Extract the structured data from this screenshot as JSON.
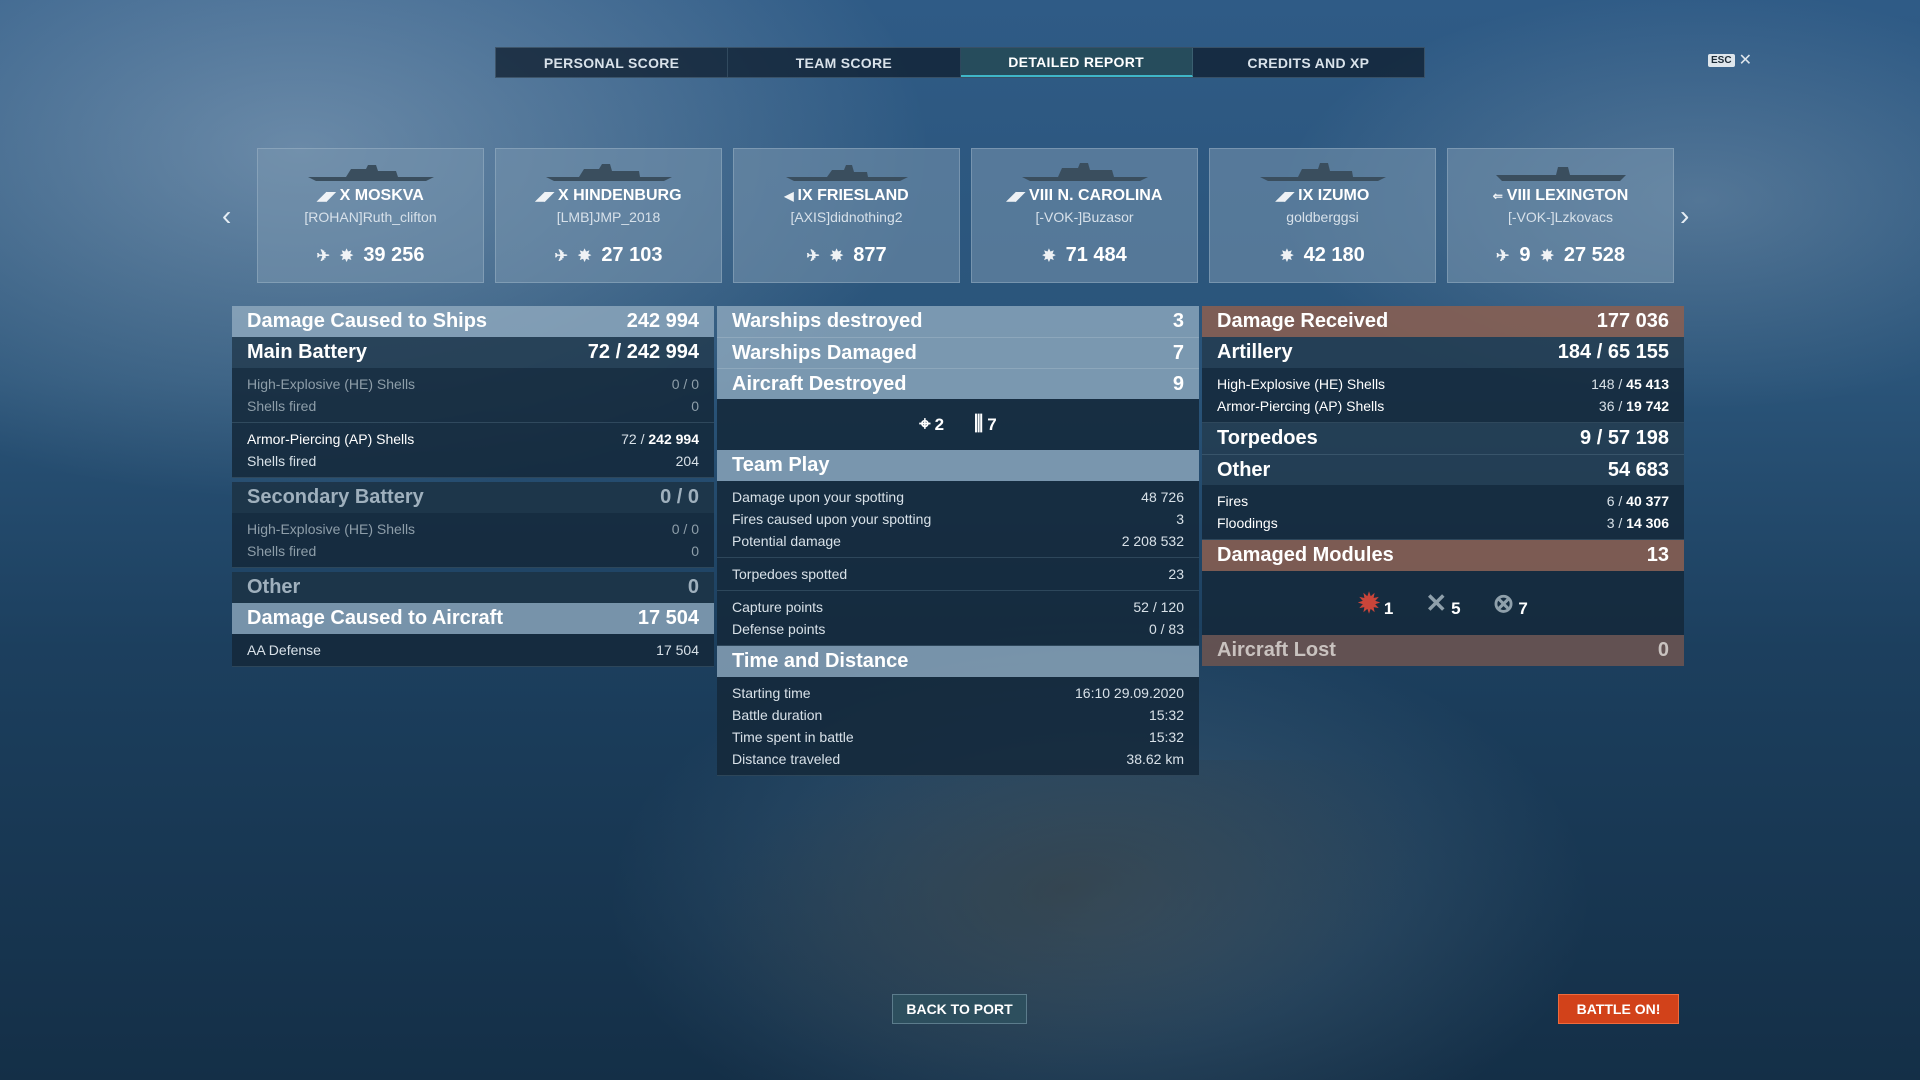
{
  "tabs": [
    {
      "label": "PERSONAL SCORE"
    },
    {
      "label": "TEAM SCORE"
    },
    {
      "label": "DETAILED REPORT"
    },
    {
      "label": "CREDITS AND XP"
    }
  ],
  "esc": {
    "key": "ESC",
    "close": "✕"
  },
  "ships": [
    {
      "tier": "X",
      "name": "MOSKVA",
      "player": "[ROHAN]Ruth_clifton",
      "damage": "39 256",
      "has_plane": true
    },
    {
      "tier": "X",
      "name": "HINDENBURG",
      "player": "[LMB]JMP_2018",
      "damage": "27 103",
      "has_plane": true
    },
    {
      "tier": "IX",
      "name": "FRIESLAND",
      "player": "[AXIS]didnothing2",
      "damage": "877",
      "has_plane": true
    },
    {
      "tier": "VIII",
      "name": "N. CAROLINA",
      "player": "[-VOK-]Buzasor",
      "damage": "71 484",
      "has_plane": false
    },
    {
      "tier": "IX",
      "name": "IZUMO",
      "player": "goldberggsi",
      "damage": "42 180",
      "has_plane": false
    },
    {
      "tier": "VIII",
      "name": "LEXINGTON",
      "player": "[-VOK-]Lzkovacs",
      "damage": "27 528",
      "planes_shot": "9"
    }
  ],
  "left": {
    "damage_ships": {
      "label": "Damage Caused to Ships",
      "value": "242 994"
    },
    "main_battery": {
      "label": "Main Battery",
      "hits": "72 /",
      "value": "242 994"
    },
    "mb_he": {
      "label": "High-Explosive (HE) Shells",
      "value": "0 / 0"
    },
    "mb_he_fired": {
      "label": "Shells fired",
      "value": "0"
    },
    "mb_ap": {
      "label": "Armor-Piercing (AP) Shells",
      "hits": "72 /",
      "value": "242 994"
    },
    "mb_ap_fired": {
      "label": "Shells fired",
      "value": "204"
    },
    "secondary": {
      "label": "Secondary Battery",
      "value": "0 / 0"
    },
    "sec_he": {
      "label": "High-Explosive (HE) Shells",
      "value": "0 / 0"
    },
    "sec_he_fired": {
      "label": "Shells fired",
      "value": "0"
    },
    "other": {
      "label": "Other",
      "value": "0"
    },
    "damage_aircraft": {
      "label": "Damage Caused to Aircraft",
      "value": "17 504"
    },
    "aa": {
      "label": "AA Defense",
      "value": "17 504"
    }
  },
  "mid": {
    "warships_destroyed": {
      "label": "Warships destroyed",
      "value": "3"
    },
    "warships_damaged": {
      "label": "Warships Damaged",
      "value": "7"
    },
    "aircraft_destroyed": {
      "label": "Aircraft Destroyed",
      "value": "9"
    },
    "icon_a": "2",
    "icon_b": "7",
    "team_play": {
      "label": "Team Play"
    },
    "spotting_dmg": {
      "label": "Damage upon your spotting",
      "value": "48 726"
    },
    "spotting_fires": {
      "label": "Fires caused upon your spotting",
      "value": "3"
    },
    "potential": {
      "label": "Potential damage",
      "value": "2 208 532"
    },
    "torps_spotted": {
      "label": "Torpedoes spotted",
      "value": "23"
    },
    "capture": {
      "label": "Capture points",
      "value": "52 / 120"
    },
    "defense": {
      "label": "Defense points",
      "value": "0 / 83"
    },
    "time_distance": {
      "label": "Time and Distance"
    },
    "start": {
      "label": "Starting time",
      "value": "16:10  29.09.2020"
    },
    "duration": {
      "label": "Battle duration",
      "value": "15:32"
    },
    "time_spent": {
      "label": "Time spent in battle",
      "value": "15:32"
    },
    "distance": {
      "label": "Distance traveled",
      "value": "38.62 km"
    }
  },
  "right": {
    "damage_received": {
      "label": "Damage Received",
      "value": "177 036"
    },
    "artillery": {
      "label": "Artillery",
      "hits": "184 /",
      "value": "65 155"
    },
    "art_he": {
      "label": "High-Explosive (HE) Shells",
      "hits": "148 /",
      "value": "45 413"
    },
    "art_ap": {
      "label": "Armor-Piercing (AP) Shells",
      "hits": "36 /",
      "value": "19 742"
    },
    "torpedoes": {
      "label": "Torpedoes",
      "hits": "9 /",
      "value": "57 198"
    },
    "other": {
      "label": "Other",
      "value": "54 683"
    },
    "fires": {
      "label": "Fires",
      "hits": "6 /",
      "value": "40 377"
    },
    "floodings": {
      "label": "Floodings",
      "hits": "3 /",
      "value": "14 306"
    },
    "damaged_modules": {
      "label": "Damaged Modules",
      "value": "13"
    },
    "mod_1": "1",
    "mod_2": "5",
    "mod_3": "7",
    "aircraft_lost": {
      "label": "Aircraft Lost",
      "value": "0"
    }
  },
  "buttons": {
    "back": "BACK TO PORT",
    "battle": "BATTLE ON!"
  }
}
